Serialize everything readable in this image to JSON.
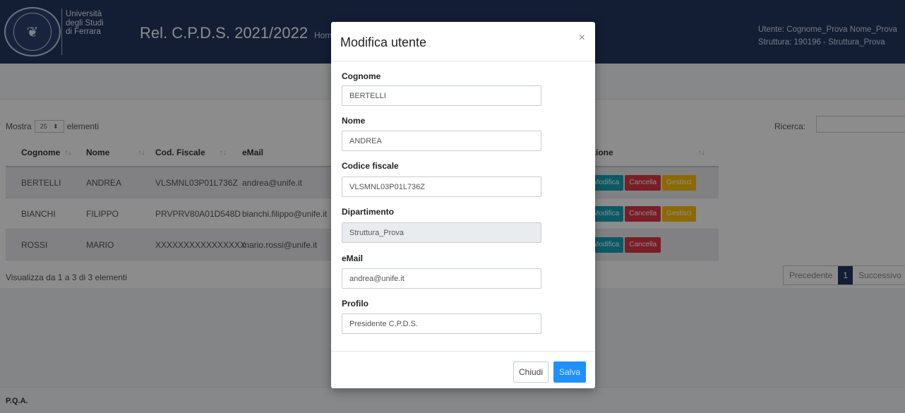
{
  "header": {
    "university_lines": [
      "Università",
      "degli Studi",
      "di Ferrara"
    ],
    "app_title": "Rel. C.P.D.S. 2021/2022",
    "nav_home": "Hom",
    "user_line": "Utente: Cognome_Prova Nome_Prova",
    "struttura_line": "Struttura: 190196 - Struttura_Prova"
  },
  "list": {
    "show_prefix": "Mostra",
    "page_size": "25",
    "show_suffix": "elementi",
    "search_label": "Ricerca:",
    "columns": [
      "Cognome",
      "Nome",
      "Cod. Fiscale",
      "eMail",
      "zione"
    ],
    "rows": [
      {
        "cognome": "BERTELLI",
        "nome": "ANDREA",
        "cf": "VLSMNL03P01L736Z",
        "email": "andrea@unife.it",
        "actions": [
          "Modifica",
          "Cancella",
          "Gestisci"
        ]
      },
      {
        "cognome": "BIANCHI",
        "nome": "FILIPPO",
        "cf": "PRVPRV80A01D548D",
        "email": "bianchi.filippo@unife.it",
        "actions": [
          "Modifica",
          "Cancella",
          "Gestisci"
        ]
      },
      {
        "cognome": "ROSSI",
        "nome": "MARIO",
        "cf": "XXXXXXXXXXXXXXXX",
        "email": "mario.rossi@unife.it",
        "actions": [
          "Modifica",
          "Cancella"
        ]
      }
    ],
    "info": "Visualizza da 1 a 3 di 3 elementi",
    "pager": {
      "prev": "Precedente",
      "current": "1",
      "next": "Successivo"
    }
  },
  "footer": {
    "text": "P.Q.A."
  },
  "modal": {
    "title": "Modifica utente",
    "close_glyph": "×",
    "fields": {
      "cognome": {
        "label": "Cognome",
        "value": "BERTELLI"
      },
      "nome": {
        "label": "Nome",
        "value": "ANDREA"
      },
      "cf": {
        "label": "Codice fiscale",
        "value": "VLSMNL03P01L736Z"
      },
      "dipartimento": {
        "label": "Dipartimento",
        "value": "Struttura_Prova"
      },
      "email": {
        "label": "eMail",
        "value": "andrea@unife.it"
      },
      "profilo": {
        "label": "Profilo",
        "value": "Presidente C.P.D.S."
      }
    },
    "close_label": "Chiudi",
    "save_label": "Salva"
  },
  "colors": {
    "header_bg": "#23365f",
    "modifica": "#17a2b8",
    "cancella": "#dc3545",
    "gestisci": "#ffc107",
    "primary": "#1e90ff"
  }
}
